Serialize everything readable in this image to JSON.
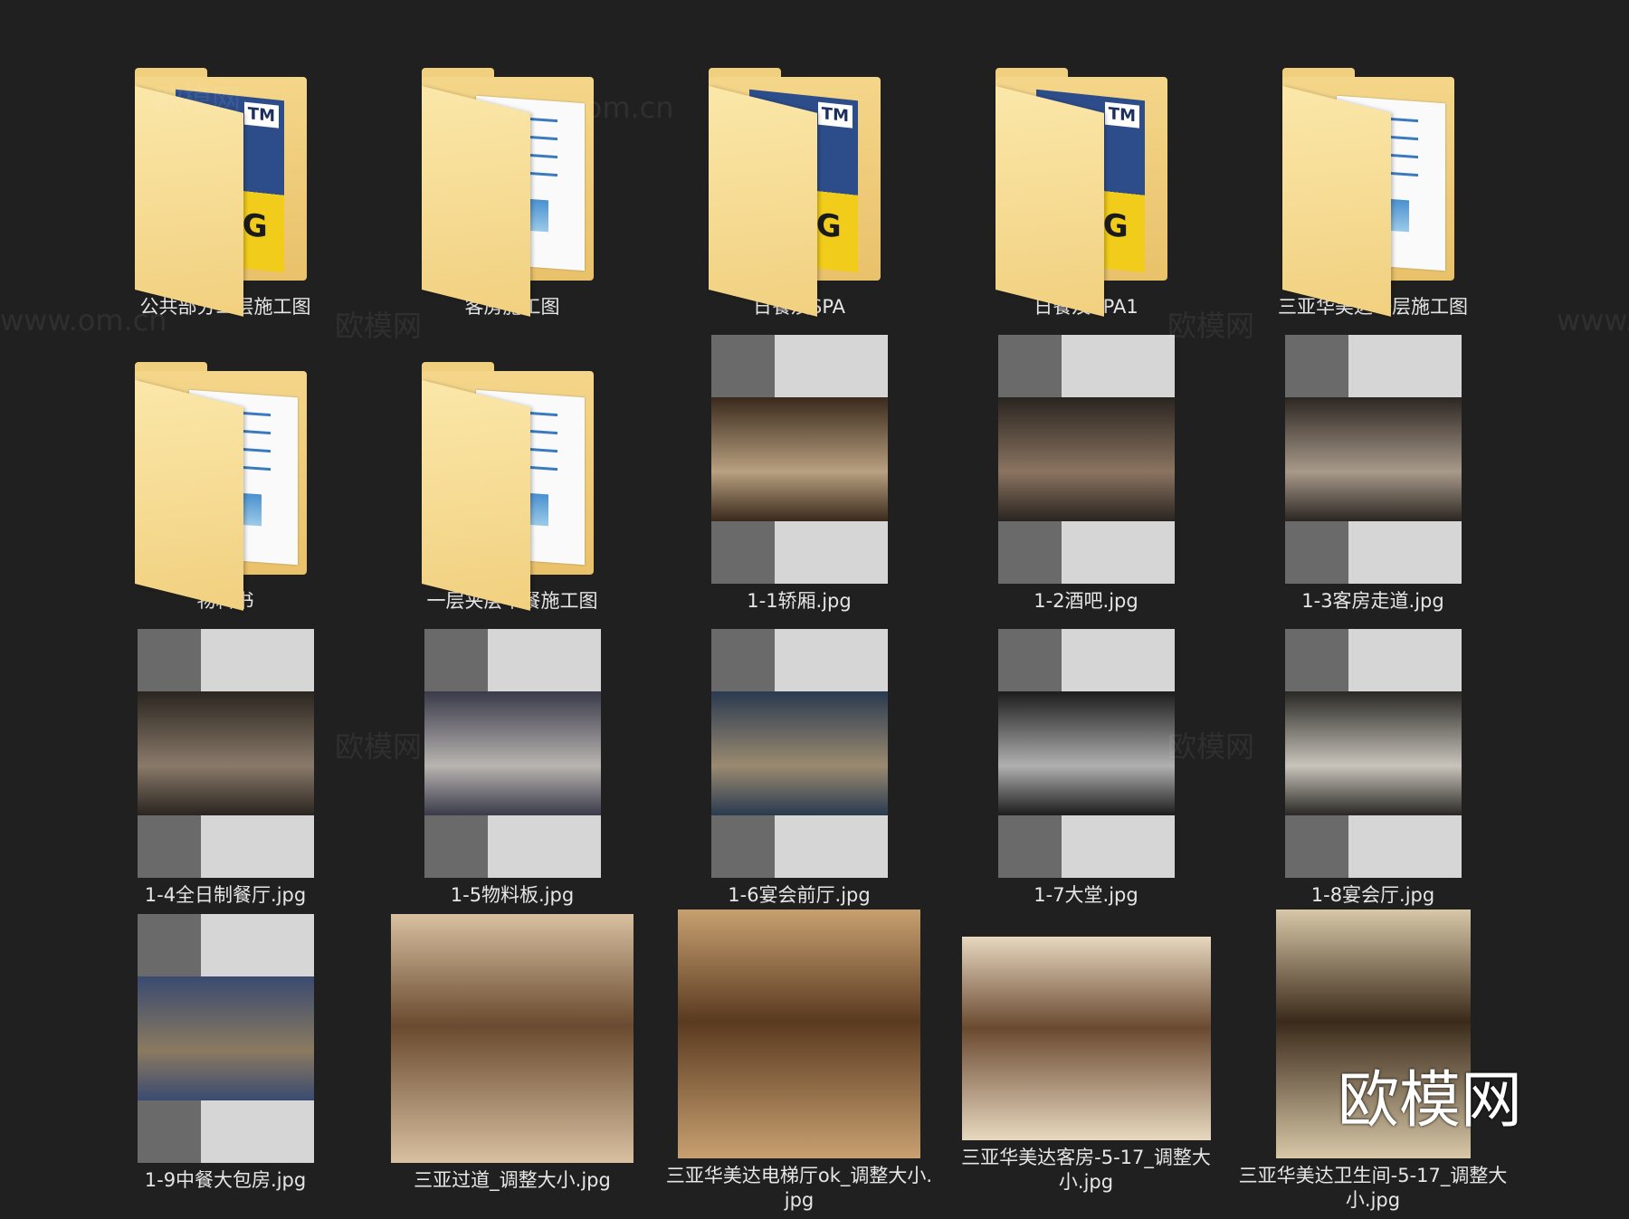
{
  "items": [
    {
      "label": "公共部分二层施工图",
      "kind": "folder-dwg"
    },
    {
      "label": "客房施工图",
      "kind": "folder"
    },
    {
      "label": "日餐及SPA",
      "kind": "folder-dwg"
    },
    {
      "label": "日餐及SPA1",
      "kind": "folder-dwg"
    },
    {
      "label": "三亚华美达一层施工图",
      "kind": "folder"
    },
    {
      "label": "物料书",
      "kind": "folder"
    },
    {
      "label": "一层夹层中餐施工图",
      "kind": "folder"
    },
    {
      "label": "1-1轿厢.jpg",
      "kind": "image-portrait",
      "palette": [
        "#3a2a1c",
        "#b8a080"
      ]
    },
    {
      "label": "1-2酒吧.jpg",
      "kind": "image-portrait",
      "palette": [
        "#2a2420",
        "#8a7460"
      ]
    },
    {
      "label": "1-3客房走道.jpg",
      "kind": "image-portrait",
      "palette": [
        "#2c2622",
        "#a89a8a"
      ]
    },
    {
      "label": "1-4全日制餐厅.jpg",
      "kind": "image-portrait",
      "palette": [
        "#2a2520",
        "#8a7a6a"
      ]
    },
    {
      "label": "1-5物料板.jpg",
      "kind": "image-portrait",
      "palette": [
        "#3a3a4a",
        "#b8b4b0"
      ]
    },
    {
      "label": "1-6宴会前厅.jpg",
      "kind": "image-portrait",
      "palette": [
        "#2a3a50",
        "#9a8a70"
      ]
    },
    {
      "label": "1-7大堂.jpg",
      "kind": "image-portrait",
      "palette": [
        "#1c1c1c",
        "#b0b0b0"
      ]
    },
    {
      "label": "1-8宴会厅.jpg",
      "kind": "image-portrait",
      "palette": [
        "#2a2824",
        "#c8c4bc"
      ]
    },
    {
      "label": "1-9中餐大包房.jpg",
      "kind": "image-portrait",
      "palette": [
        "#3a4a70",
        "#8a7a60"
      ]
    },
    {
      "label": "三亚过道_调整大小.jpg",
      "kind": "image-land",
      "palette": [
        "#6a4a30",
        "#d8c0a0"
      ]
    },
    {
      "label": "三亚华美达电梯厅ok_调整大小.jpg",
      "kind": "image-land",
      "palette": [
        "#5a3a20",
        "#c8a070"
      ]
    },
    {
      "label": "三亚华美达客房-5-17_调整大小.jpg",
      "kind": "image-wide",
      "palette": [
        "#6a4a30",
        "#e8d8c0"
      ]
    },
    {
      "label": "三亚华美达卫生间-5-17_调整大小.jpg",
      "kind": "image-tall",
      "palette": [
        "#3a2a1a",
        "#d8c8a8"
      ]
    }
  ],
  "watermarks": {
    "site": "www.om.cn",
    "brand": "欧模网"
  },
  "logo": "欧模网"
}
